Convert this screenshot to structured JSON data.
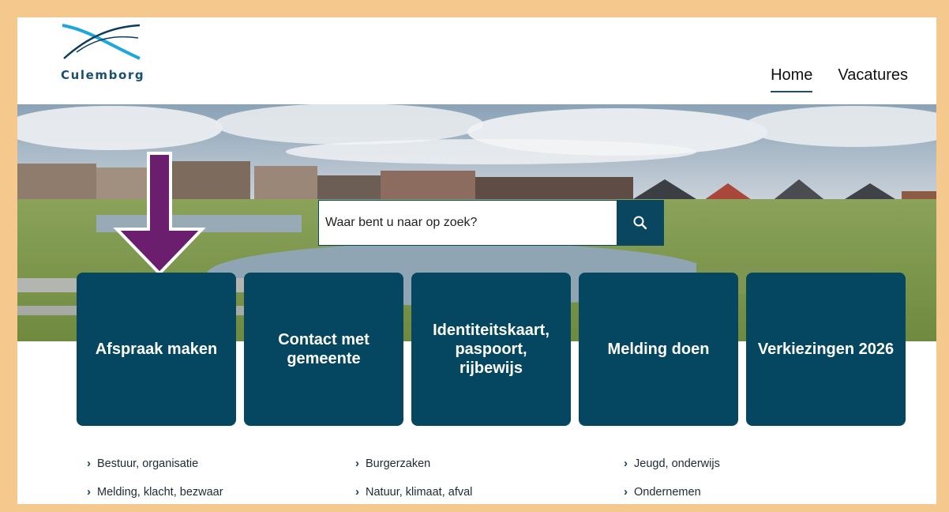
{
  "brand": {
    "name": "Culemborg"
  },
  "nav": {
    "home": "Home",
    "vacatures": "Vacatures"
  },
  "search": {
    "placeholder": "Waar bent u naar op zoek?"
  },
  "tiles": [
    {
      "label": "Afspraak maken"
    },
    {
      "label": "Contact met gemeente"
    },
    {
      "label": "Identiteitskaart, paspoort, rijbewijs"
    },
    {
      "label": "Melding doen"
    },
    {
      "label": "Verkiezingen 2026"
    }
  ],
  "links": [
    {
      "label": "Bestuur, organisatie"
    },
    {
      "label": "Burgerzaken"
    },
    {
      "label": "Jeugd, onderwijs"
    },
    {
      "label": "Melding, klacht, bezwaar"
    },
    {
      "label": "Natuur, klimaat, afval"
    },
    {
      "label": "Ondernemen"
    }
  ],
  "colors": {
    "frame": "#f5c98d",
    "primary": "#054660",
    "arrow": "#6b1d6e"
  }
}
